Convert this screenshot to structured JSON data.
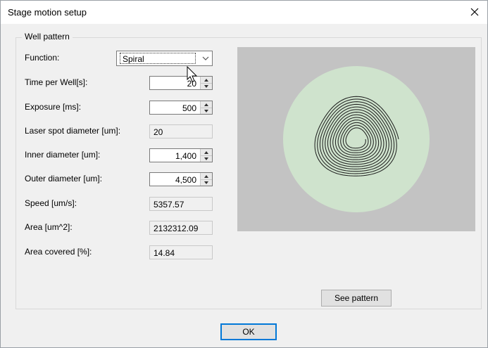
{
  "window": {
    "title": "Stage motion setup"
  },
  "group": {
    "title": "Well pattern"
  },
  "function": {
    "label": "Function:",
    "value": "Spiral"
  },
  "fields": {
    "time_per_well": {
      "label": "Time per Well[s]:",
      "value": "20"
    },
    "exposure": {
      "label": "Exposure [ms]:",
      "value": "500"
    },
    "laser_spot": {
      "label": "Laser spot diameter [um]:",
      "value": "20"
    },
    "inner_diameter": {
      "label": "Inner diameter [um]:",
      "value": "1,400"
    },
    "outer_diameter": {
      "label": "Outer diameter [um]:",
      "value": "4,500"
    },
    "speed": {
      "label": "Speed [um/s]:",
      "value": "5357.57"
    },
    "area": {
      "label": "Area [um^2]:",
      "value": "2132312.09"
    },
    "area_covered": {
      "label": "Area covered [%]:",
      "value": "14.84"
    }
  },
  "buttons": {
    "see_pattern": "See pattern",
    "ok": "OK"
  },
  "colors": {
    "preview_bg": "#c3c3c3",
    "well_fill": "#cfe3cd",
    "spiral": "#1a1a1a",
    "accent": "#0078d7"
  },
  "icons": {
    "close": "close-icon",
    "dropdown": "chevron-down-icon",
    "spin_up": "spin-up-icon",
    "spin_down": "spin-down-icon",
    "cursor": "mouse-cursor-icon"
  }
}
